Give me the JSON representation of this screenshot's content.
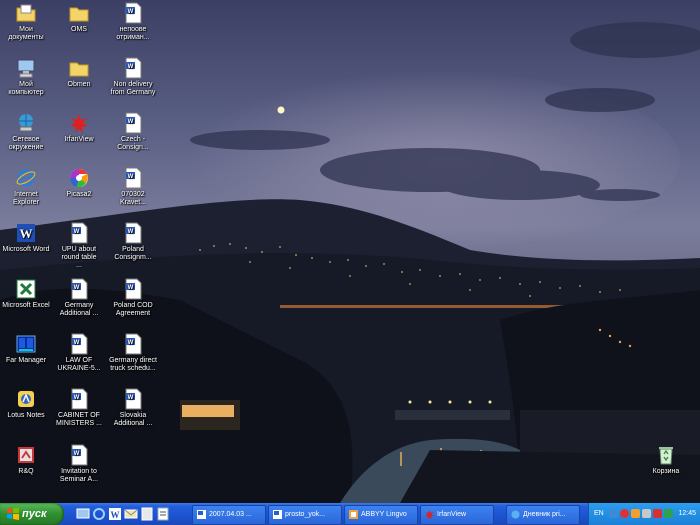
{
  "desktop": {
    "icons": [
      {
        "label": "Мои\nдокументы",
        "icon": "folder-icon"
      },
      {
        "label": "OMS",
        "icon": "folder-icon"
      },
      {
        "label": "непоове\nотриман...",
        "icon": "word-doc-icon"
      },
      {
        "label": "Мой\nкомпьютер",
        "icon": "computer-icon"
      },
      {
        "label": "Obmen",
        "icon": "folder-icon"
      },
      {
        "label": "Non delivery\nfrom Germany",
        "icon": "word-doc-icon"
      },
      {
        "label": "Сетевое\nокружение",
        "icon": "network-icon"
      },
      {
        "label": "IrfanView",
        "icon": "irfanview-icon"
      },
      {
        "label": "Czech -\nConsign...",
        "icon": "word-doc-icon"
      },
      {
        "label": "Internet\nExplorer",
        "icon": "ie-icon"
      },
      {
        "label": "Picasa2",
        "icon": "picasa-icon"
      },
      {
        "label": "070302\nKravet...",
        "icon": "word-doc-icon"
      },
      {
        "label": "Microsoft Word",
        "icon": "word-app-icon"
      },
      {
        "label": "UPU about\nround table\n...",
        "icon": "word-doc-icon"
      },
      {
        "label": "Poland\nConsignm...",
        "icon": "word-doc-icon"
      },
      {
        "label": "Microsoft Excel",
        "icon": "excel-app-icon"
      },
      {
        "label": "Germany\nAdditional ...",
        "icon": "word-doc-icon"
      },
      {
        "label": "Poland COD\nAgreement",
        "icon": "word-doc-icon"
      },
      {
        "label": "Far Manager",
        "icon": "far-manager-icon"
      },
      {
        "label": "LAW OF\nUKRAINE-5...",
        "icon": "word-doc-icon"
      },
      {
        "label": "Germany direct\ntruck schedu...",
        "icon": "word-doc-icon"
      },
      {
        "label": "Lotus Notes",
        "icon": "lotus-notes-icon"
      },
      {
        "label": "CABINET OF\nMINISTERS ...",
        "icon": "word-doc-icon"
      },
      {
        "label": "Slovakia\nAdditional ...",
        "icon": "word-doc-icon"
      },
      {
        "label": "R&Q",
        "icon": "rq-app-icon"
      },
      {
        "label": "Invitation to\nSeminar A...",
        "icon": "word-doc-icon"
      },
      {
        "label": "Корзина",
        "icon": "recycle-bin-icon"
      }
    ]
  },
  "taskbar": {
    "start_label": "пуск",
    "quick_launch": [
      "show-desktop-icon",
      "ie-icon",
      "word-app-icon",
      "outlook-icon",
      "explorer-icon",
      "notes-icon"
    ],
    "tasks": [
      {
        "label": "2007.04.03 ...",
        "icon": "word-doc-icon"
      },
      {
        "label": "prosto_yok...",
        "icon": "word-doc-icon"
      },
      {
        "label": "ABBYY Lingvo",
        "icon": "lingvo-icon"
      },
      {
        "label": "IrfanView",
        "icon": "irfanview-icon"
      },
      {
        "label": "Дневник pri...",
        "icon": "browser-icon"
      }
    ],
    "tray": {
      "language": "EN",
      "clock": "12:45",
      "icons": [
        "antivirus-icon",
        "security-icon",
        "network-tray-icon",
        "volume-icon",
        "kaspersky-icon",
        "update-icon"
      ]
    }
  }
}
